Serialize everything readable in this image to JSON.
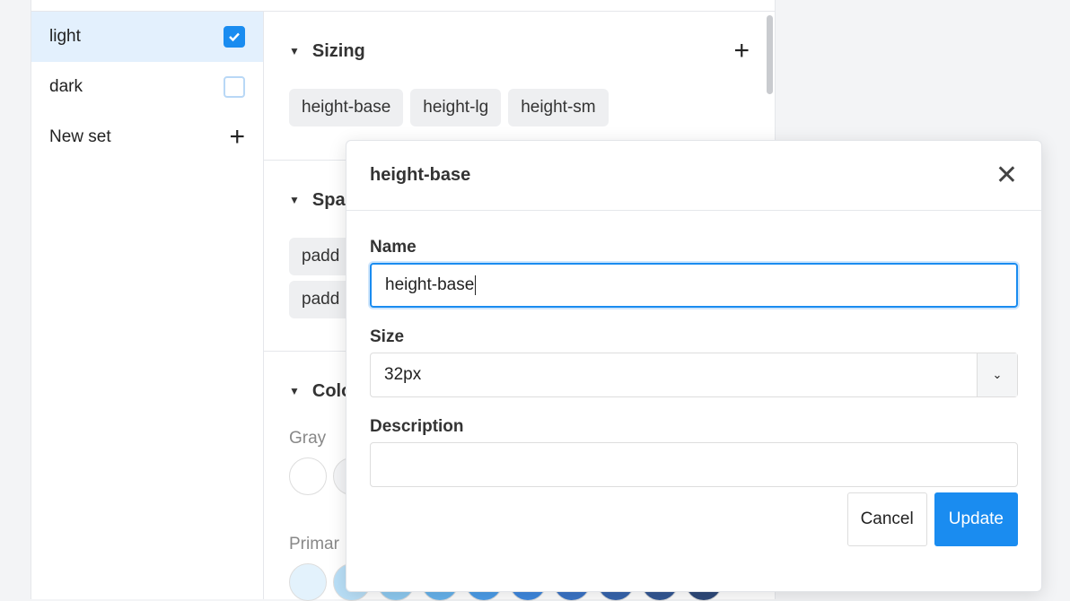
{
  "sets": [
    {
      "label": "light",
      "checked": true
    },
    {
      "label": "dark",
      "checked": false
    }
  ],
  "new_set_label": "New set",
  "sections": {
    "sizing": {
      "title": "Sizing",
      "chips": [
        "height-base",
        "height-lg",
        "height-sm"
      ]
    },
    "spacing": {
      "title": "Spa",
      "chips": [
        "padd",
        "padd"
      ]
    },
    "colors": {
      "title": "Colo",
      "groups": [
        {
          "name": "Gray",
          "swatches": [
            "#ffffff",
            "#f3f4f6"
          ]
        },
        {
          "name": "Primar",
          "swatches": [
            "#e3f2fc",
            "#b9dff7",
            "#8ecaf1",
            "#67b3ec",
            "#4c9de8",
            "#3f88de",
            "#3b74c6",
            "#3765ad",
            "#345894",
            "#2f4a7a"
          ]
        }
      ]
    }
  },
  "modal": {
    "title": "height-base",
    "name_label": "Name",
    "name_value": "height-base",
    "size_label": "Size",
    "size_value": "32px",
    "description_label": "Description",
    "description_value": "",
    "cancel": "Cancel",
    "update": "Update"
  }
}
